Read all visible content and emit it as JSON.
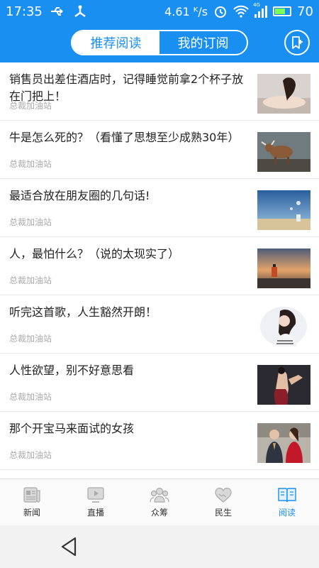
{
  "status": {
    "time": "17:35",
    "speed": "4.61 ᴷ/s",
    "battery": "70",
    "network": "4G",
    "icons": [
      "usb-icon",
      "nfc-icon",
      "alarm-icon",
      "wifi-icon",
      "signal-icon",
      "battery-icon"
    ]
  },
  "header": {
    "tabs": [
      {
        "label": "推荐阅读",
        "active": true
      },
      {
        "label": "我的订阅",
        "active": false
      }
    ],
    "bookmark_icon": "bookmark-add-icon"
  },
  "articles": [
    {
      "title": "销售员出差住酒店时，记得睡觉前拿2个杯子放在门把上！",
      "source": "总裁加油站"
    },
    {
      "title": "牛是怎么死的？（看懂了思想至少成熟30年）",
      "source": "总裁加油站"
    },
    {
      "title": "最适合放在朋友圈的几句话!",
      "source": "总裁加油站"
    },
    {
      "title": "人，最怕什么？（说的太现实了）",
      "source": "总裁加油站"
    },
    {
      "title": "听完这首歌，人生豁然开朗！",
      "source": "总裁加油站"
    },
    {
      "title": "人性欲望，别不好意思看",
      "source": "总裁加油站"
    },
    {
      "title": "那个开宝马来面试的女孩",
      "source": "总裁加油站"
    }
  ],
  "tabbar": [
    {
      "label": "新闻",
      "icon": "newspaper-icon",
      "active": false
    },
    {
      "label": "直播",
      "icon": "live-play-icon",
      "active": false
    },
    {
      "label": "众筹",
      "icon": "crowdfunding-icon",
      "active": false
    },
    {
      "label": "民生",
      "icon": "handshake-icon",
      "active": false
    },
    {
      "label": "阅读",
      "icon": "book-icon",
      "active": true
    }
  ],
  "colors": {
    "brand": "#1a8ff2",
    "active_tab": "#1a8ff2"
  }
}
